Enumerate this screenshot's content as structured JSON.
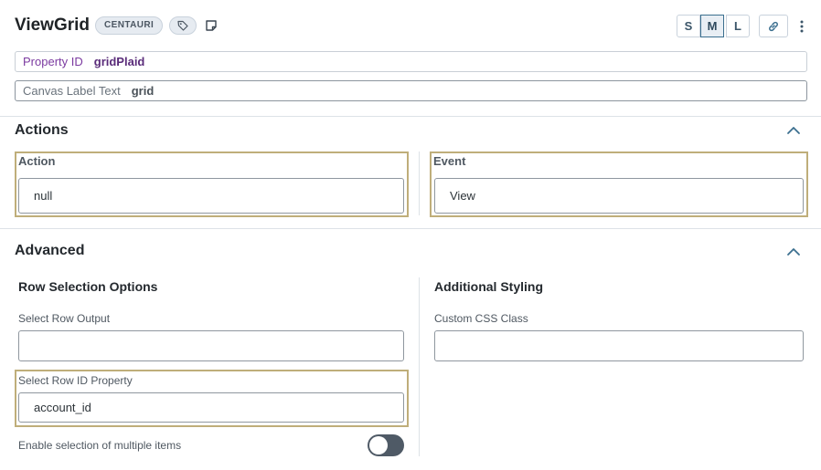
{
  "header": {
    "title": "ViewGrid",
    "badge": "CENTAURI",
    "sizes": [
      "S",
      "M",
      "L"
    ],
    "selected_size": "M"
  },
  "property_id": {
    "label": "Property ID",
    "value": "gridPlaid"
  },
  "canvas_label": {
    "label": "Canvas Label Text",
    "value": "grid"
  },
  "actions": {
    "title": "Actions",
    "action": {
      "label": "Action",
      "value": "null"
    },
    "event": {
      "label": "Event",
      "value": "View"
    }
  },
  "advanced": {
    "title": "Advanced",
    "row_selection": {
      "title": "Row Selection Options",
      "select_row_output": {
        "label": "Select Row Output",
        "value": ""
      },
      "select_row_id": {
        "label": "Select Row ID Property",
        "value": "account_id"
      },
      "multi_select": {
        "label": "Enable selection of multiple items",
        "enabled": false
      }
    },
    "additional_styling": {
      "title": "Additional Styling",
      "custom_css": {
        "label": "Custom CSS Class",
        "value": ""
      }
    }
  },
  "colors": {
    "highlight_border": "#bfae7a",
    "property_label": "#7b3aa0",
    "toggle_off": "#4f5a66"
  }
}
